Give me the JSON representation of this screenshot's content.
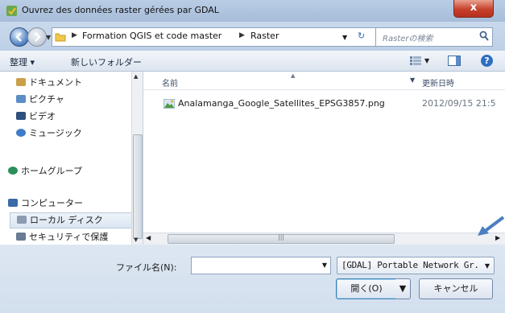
{
  "window": {
    "title": "Ouvrez des données raster gérées par GDAL",
    "close_label": "x"
  },
  "address": {
    "breadcrumbs": [
      "Formation QGIS et code master",
      "Raster"
    ],
    "search_placeholder": "Rasterの検索"
  },
  "toolbar": {
    "organize": "整理 ▾",
    "new_folder": "新しいフォルダー"
  },
  "navpane": {
    "items": [
      {
        "label": "ドキュメント",
        "icon": "documents-icon"
      },
      {
        "label": "ピクチャ",
        "icon": "pictures-icon"
      },
      {
        "label": "ビデオ",
        "icon": "videos-icon"
      },
      {
        "label": "ミュージック",
        "icon": "music-icon"
      },
      {
        "label": "ホームグループ",
        "icon": "homegroup-icon"
      },
      {
        "label": "コンピューター",
        "icon": "computer-icon"
      },
      {
        "label": "ローカル ディスク",
        "icon": "drive-icon"
      },
      {
        "label": "セキュリティで保護",
        "icon": "secure-drive-icon"
      }
    ]
  },
  "filelist": {
    "columns": {
      "name": "名前",
      "date": "更新日時"
    },
    "files": [
      {
        "name": "Analamanga_Google_Satellites_EPSG3857.png",
        "date": "2012/09/15 21:5"
      }
    ]
  },
  "bottom": {
    "filename_label": "ファイル名(N):",
    "filename_value": "",
    "filetype": "[GDAL] Portable Network Gr.",
    "open_label": "開く(O)",
    "cancel_label": "キャンセル"
  },
  "colors": {
    "accent": "#2d6fc0",
    "close": "#c7412c",
    "annotation_arrow": "#4a7fc1"
  }
}
